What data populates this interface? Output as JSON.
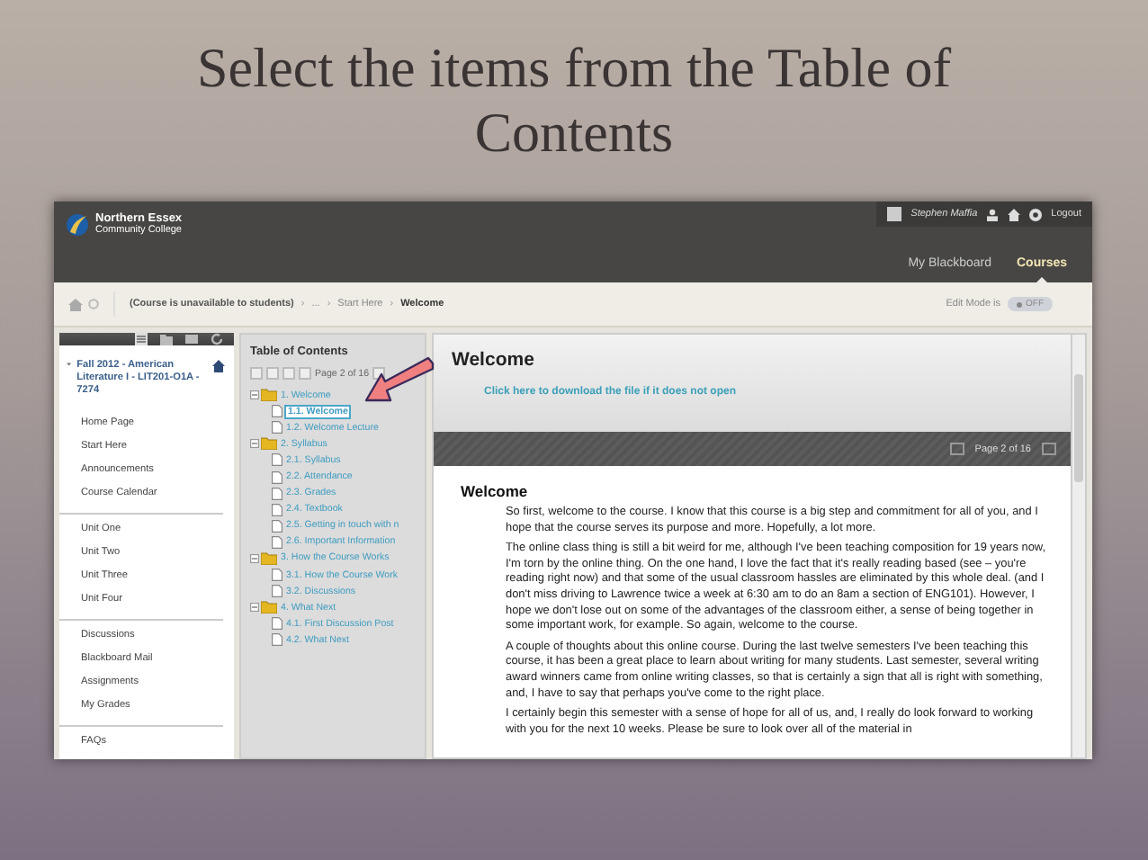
{
  "slide": {
    "title": "Select the items from the Table of Contents"
  },
  "header": {
    "logo_line1": "Northern Essex",
    "logo_line2": "Community College",
    "user_name": "Stephen Maffia",
    "logout": "Logout",
    "nav": [
      {
        "label": "My Blackboard",
        "selected": false
      },
      {
        "label": "Courses",
        "selected": true
      }
    ]
  },
  "breadcrumb": {
    "items": [
      "(Course is unavailable to students)",
      "...",
      "Start Here",
      "Welcome"
    ],
    "separator": "›"
  },
  "edit_mode": {
    "label": "Edit Mode is",
    "toggle": "OFF",
    "on": false
  },
  "sidebar": {
    "course_title": "Fall 2012 - American Literature I - LIT201-O1A - 7274",
    "expanded": true,
    "groups": [
      [
        "Home Page",
        "Start Here",
        "Announcements",
        "Course Calendar"
      ],
      [
        "Unit One",
        "Unit Two",
        "Unit Three",
        "Unit Four"
      ],
      [
        "Discussions",
        "Blackboard Mail",
        "Assignments",
        "My Grades"
      ],
      [
        "FAQs"
      ]
    ]
  },
  "toc": {
    "title": "Table of Contents",
    "page": "Page 2 of 16",
    "items": [
      {
        "label": "1. Welcome",
        "selected": false,
        "expanded": true,
        "children": [
          {
            "label": "1.1. Welcome",
            "selected": true
          },
          {
            "label": "1.2. Welcome Lecture",
            "selected": false
          }
        ]
      },
      {
        "label": "2. Syllabus",
        "selected": false,
        "expanded": true,
        "children": [
          {
            "label": "2.1. Syllabus",
            "selected": false
          },
          {
            "label": "2.2. Attendance",
            "selected": false
          },
          {
            "label": "2.3. Grades",
            "selected": false
          },
          {
            "label": "2.4. Textbook",
            "selected": false
          },
          {
            "label": "2.5. Getting in touch with n",
            "selected": false
          },
          {
            "label": "2.6. Important Information",
            "selected": false
          }
        ]
      },
      {
        "label": "3. How the Course Works",
        "selected": false,
        "expanded": true,
        "children": [
          {
            "label": "3.1. How the Course Work",
            "selected": false
          },
          {
            "label": "3.2. Discussions",
            "selected": false
          }
        ]
      },
      {
        "label": "4. What Next",
        "selected": false,
        "expanded": true,
        "children": [
          {
            "label": "4.1. First Discussion Post",
            "selected": false
          },
          {
            "label": "4.2. What Next",
            "selected": false
          }
        ]
      }
    ]
  },
  "content": {
    "title": "Welcome",
    "link": "Click here to download the file if it does not open",
    "page": "Page 2 of 16",
    "doc_title": "Welcome",
    "paragraphs": [
      "So first, welcome to the course. I know that this course is a big step and commitment for all of you, and I hope that the course serves its purpose and more. Hopefully, a lot more.",
      "The online class thing is still a bit weird for me, although I've been teaching composition for 19 years now, I'm torn by the online thing. On the one hand, I love the fact that it's really reading based (see – you're reading right now) and that some of the usual classroom hassles are eliminated by this whole deal. (and I don't miss driving to Lawrence twice a week at 6:30 am to do an 8am a section of ENG101). However, I hope we don't lose out on some of the advantages of the classroom either, a sense of being together in some important work, for example. So again, welcome to the course.",
      "A couple of thoughts about this online course. During the last twelve semesters I've been teaching this course, it has been a great place to learn about writing for many students. Last semester, several writing award winners came from online writing classes, so that is certainly a sign that all is right with something, and, I have to say that perhaps you've come to the right place.",
      "I certainly begin this semester with a sense of hope for all of us, and, I really do look forward to working with you for the next 10 weeks. Please be sure to look over all of the material in"
    ]
  }
}
